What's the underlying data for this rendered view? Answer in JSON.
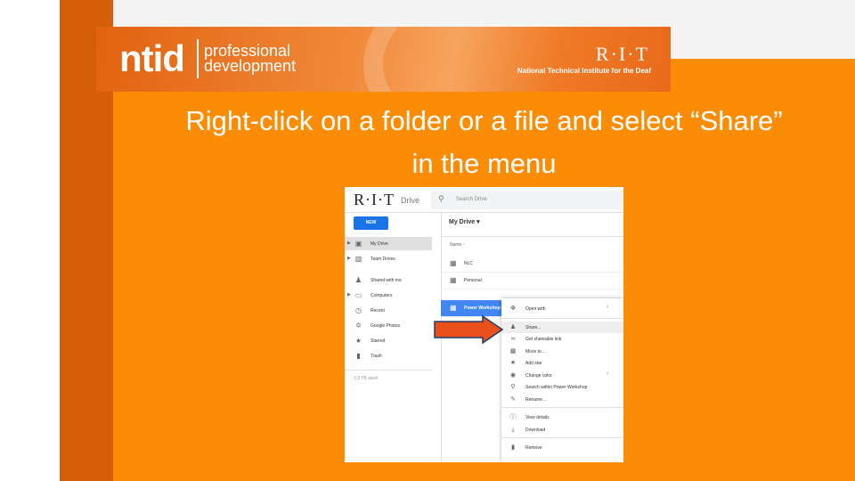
{
  "banner": {
    "ntid": "ntid",
    "pd_line1": "professional",
    "pd_line2": "development",
    "rit": "R·I·T",
    "rit_sub": "National Technical Institute for the Deaf"
  },
  "headline": {
    "line1": "Right-click on a folder or a file and select “Share”",
    "line2": "in the menu"
  },
  "drive": {
    "logo": "R·I·T",
    "logo_sub": "Drive",
    "search_placeholder": "Search Drive",
    "new_button": "NEW",
    "nav": [
      {
        "label": "My Drive",
        "icon": "my-drive-icon"
      },
      {
        "label": "Team Drives",
        "icon": "team-drives-icon"
      },
      {
        "label": "Shared with me",
        "icon": "shared-icon"
      },
      {
        "label": "Computers",
        "icon": "computer-icon"
      },
      {
        "label": "Recent",
        "icon": "clock-icon"
      },
      {
        "label": "Google Photos",
        "icon": "pinwheel-icon"
      },
      {
        "label": "Starred",
        "icon": "star-icon"
      },
      {
        "label": "Trash",
        "icon": "trash-icon"
      }
    ],
    "usage": "3.3 TB used",
    "content_title": "My Drive",
    "column_name": "Name",
    "files": [
      {
        "name": "NLC"
      },
      {
        "name": "Personal"
      },
      {
        "name": "Power Workshop"
      }
    ],
    "context_menu": [
      {
        "label": "Open with",
        "icon": "open-with-icon",
        "submenu": true
      },
      {
        "label": "Share...",
        "icon": "person-add-icon",
        "highlighted": true
      },
      {
        "label": "Get shareable link",
        "icon": "link-icon"
      },
      {
        "label": "Move to...",
        "icon": "folder-move-icon"
      },
      {
        "label": "Add star",
        "icon": "star-icon"
      },
      {
        "label": "Change color",
        "icon": "palette-icon",
        "submenu": true
      },
      {
        "label": "Search within Power Workshop",
        "icon": "search-icon"
      },
      {
        "label": "Rename...",
        "icon": "pencil-icon"
      },
      {
        "label": "View details",
        "icon": "info-icon"
      },
      {
        "label": "Download",
        "icon": "download-icon"
      },
      {
        "label": "Remove",
        "icon": "trash-icon"
      }
    ]
  },
  "colors": {
    "main_orange": "#fb8c05",
    "side_bar": "#d45f08",
    "drive_blue": "#4285f4",
    "arrow_fill": "#e8511a",
    "arrow_stroke": "#1f3a6e"
  }
}
